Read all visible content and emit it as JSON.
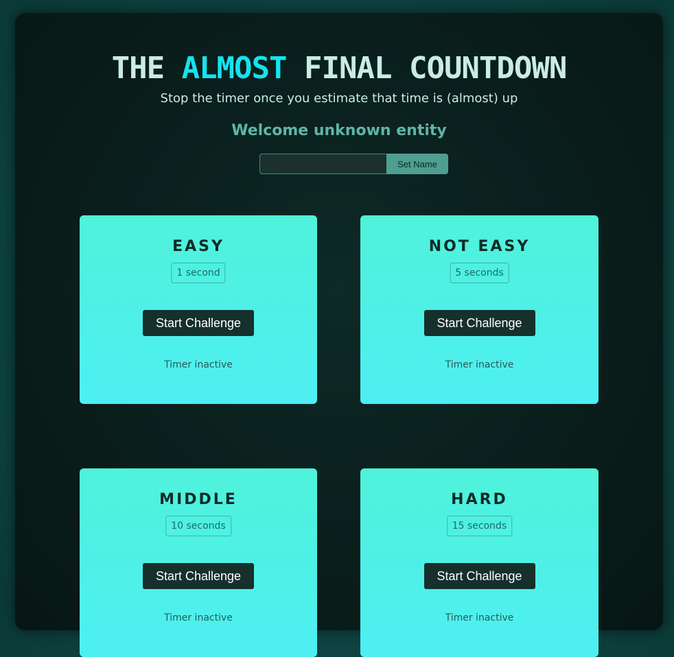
{
  "header": {
    "title_part1": "THE ",
    "title_accent": "ALMOST",
    "title_part2": " FINAL COUNTDOWN",
    "subtitle": "Stop the timer once you estimate that time is (almost) up",
    "welcome": "Welcome unknown entity"
  },
  "name_form": {
    "input_value": "",
    "input_placeholder": "",
    "button_label": "Set Name"
  },
  "challenges": [
    {
      "title": "EASY",
      "duration": "1 second",
      "button_label": "Start Challenge",
      "status": "Timer inactive"
    },
    {
      "title": "NOT EASY",
      "duration": "5 seconds",
      "button_label": "Start Challenge",
      "status": "Timer inactive"
    },
    {
      "title": "MIDDLE",
      "duration": "10 seconds",
      "button_label": "Start Challenge",
      "status": "Timer inactive"
    },
    {
      "title": "HARD",
      "duration": "15 seconds",
      "button_label": "Start Challenge",
      "status": "Timer inactive"
    }
  ],
  "colors": {
    "page_background": "#0d4341",
    "frame_background": "#0a1e1c",
    "title_text": "#c9ece4",
    "title_accent": "#14e3ee",
    "welcome_text": "#5fb5a6",
    "card_gradient_top": "#4ff2da",
    "card_gradient_bottom": "#4deff2",
    "button_background": "#16302c",
    "set_name_button": "#4f9e92"
  }
}
